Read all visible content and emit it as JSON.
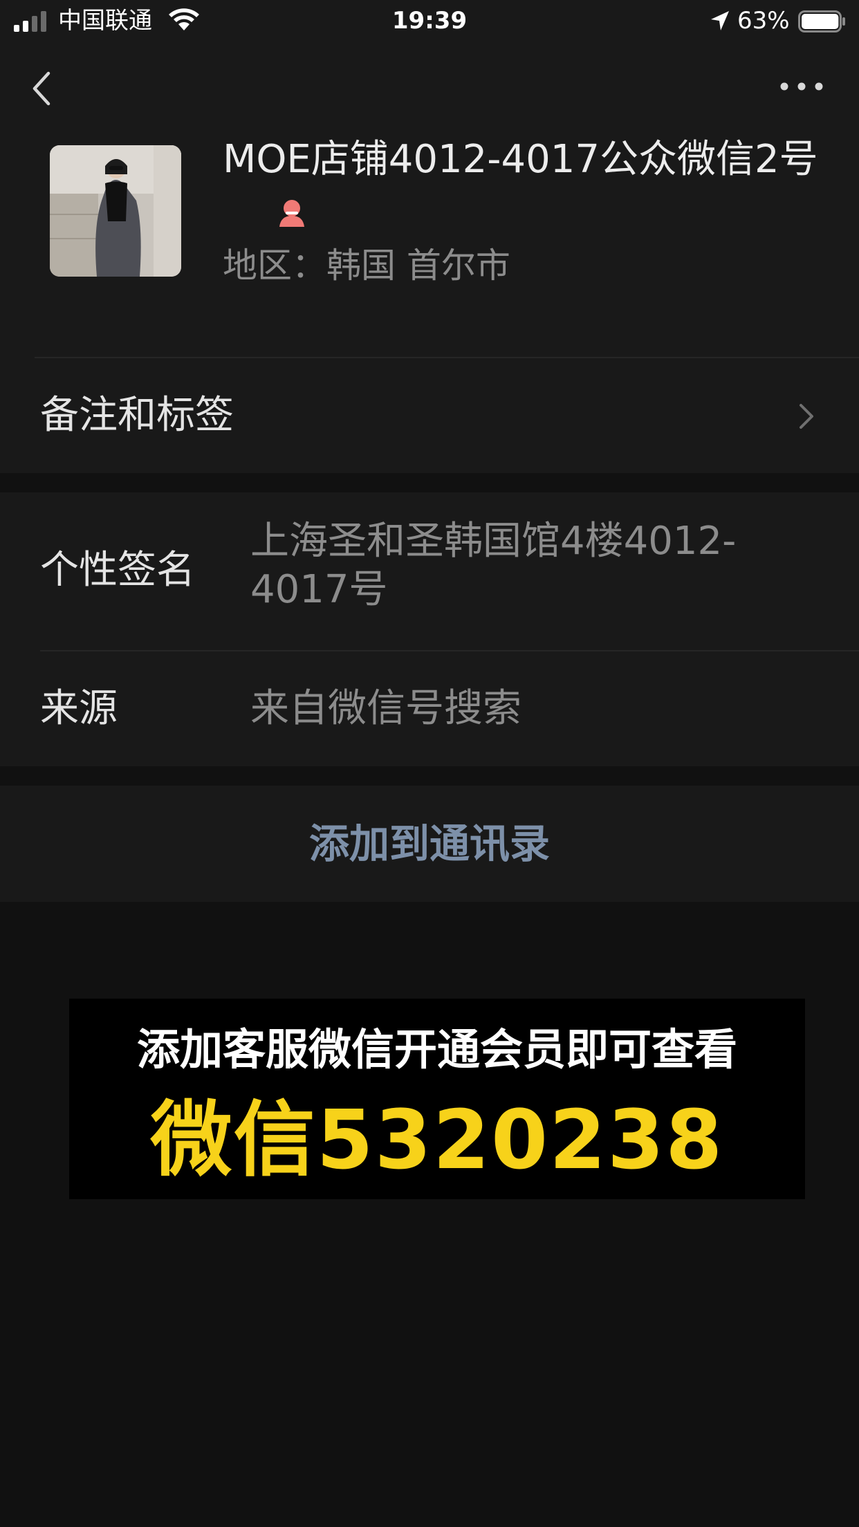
{
  "status_bar": {
    "carrier": "中国联通",
    "time": "19:39",
    "battery_percent": "63%",
    "battery_level": 0.63,
    "icons": [
      "signal-icon",
      "wifi-icon",
      "location-arrow-icon",
      "battery-icon"
    ]
  },
  "nav": {
    "back_icon": "chevron-left-icon",
    "more_icon": "more-dots-icon"
  },
  "profile": {
    "name": "MOE店铺4012-4017公众微信2号",
    "gender_icon": "female-icon",
    "region": "地区：韩国 首尔市"
  },
  "remark_row": {
    "label": "备注和标签",
    "icon": "chevron-right-icon"
  },
  "info": {
    "signature_label": "个性签名",
    "signature_value": "上海圣和圣韩国馆4楼4012-4017号",
    "source_label": "来源",
    "source_value": "来自微信号搜索"
  },
  "add_button": {
    "label": "添加到通讯录",
    "color": "#7d90a9"
  },
  "promo": {
    "line1": "添加客服微信开通会员即可查看",
    "line2": "微信5320238",
    "accent_color": "#f7d21a"
  }
}
